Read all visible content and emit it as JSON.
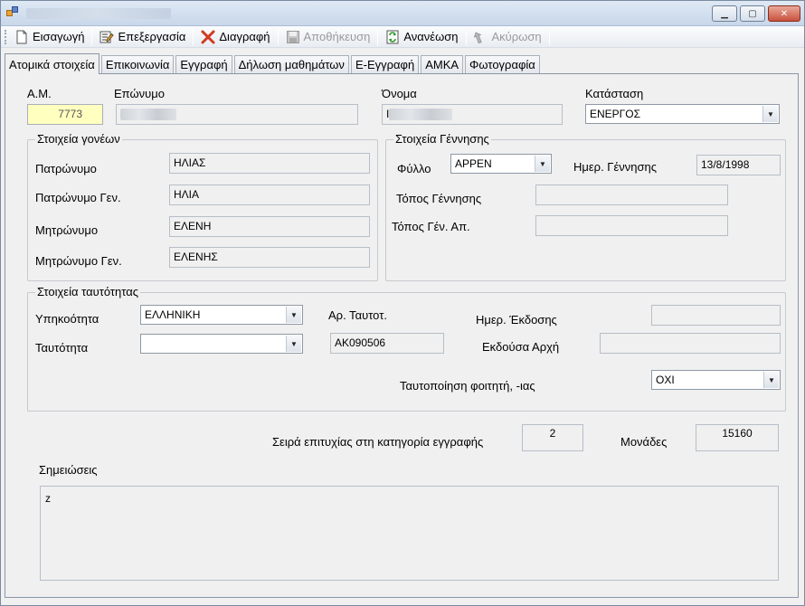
{
  "toolbar": {
    "insert": "Εισαγωγή",
    "edit": "Επεξεργασία",
    "delete": "Διαγραφή",
    "save": "Αποθήκευση",
    "refresh": "Ανανέωση",
    "cancel": "Ακύρωση",
    "disabled": [
      "save",
      "cancel"
    ]
  },
  "tabs": [
    "Ατομικά στοιχεία",
    "Επικοινωνία",
    "Εγγραφή",
    "Δήλωση μαθημάτων",
    "Ε-Εγγραφή",
    "ΑΜΚΑ",
    "Φωτογραφία"
  ],
  "active_tab": "Ατομικά στοιχεία",
  "student": {
    "am_label": "Α.Μ.",
    "am_value": "7773",
    "surname_label": "Επώνυμο",
    "name_label": "Όνομα",
    "name_prefix": "Ι",
    "status_label": "Κατάσταση",
    "status_value": "ΕΝΕΡΓΟΣ"
  },
  "parents": {
    "title": "Στοιχεία γονέων",
    "father_label": "Πατρώνυμο",
    "father_value": "ΗΛΙΑΣ",
    "father_gen_label": "Πατρώνυμο Γεν.",
    "father_gen_value": "ΗΛΙΑ",
    "mother_label": "Μητρώνυμο",
    "mother_value": "ΕΛΕΝΗ",
    "mother_gen_label": "Μητρώνυμο Γεν.",
    "mother_gen_value": "ΕΛΕΝΗΣ"
  },
  "birth": {
    "title": "Στοιχεία Γέννησης",
    "gender_label": "Φύλλο",
    "gender_value": "ΑΡΡΕΝ",
    "date_label": "Ημερ. Γέννησης",
    "date_value": "13/8/1998",
    "place_label": "Τόπος Γέννησης",
    "place_value": "",
    "place_gen_label": "Τόπος Γέν. Απ.",
    "place_gen_value": ""
  },
  "identity": {
    "title": "Στοιχεία ταυτότητας",
    "citizenship_label": "Υπηκοότητα",
    "citizenship_value": "ΕΛΛΗΝΙΚΗ",
    "id_type_label": "Ταυτότητα",
    "id_type_value": "",
    "id_number_label": "Αρ. Ταυτοτ.",
    "id_number_value": "ΑΚ090506",
    "issue_date_label": "Ημερ. Έκδοσης",
    "issue_date_value": "",
    "authority_label": "Εκδούσα Αρχή",
    "authority_value": "",
    "verified_label": "Ταυτοποίηση φοιτητή, -ιας",
    "verified_value": "ΟΧΙ"
  },
  "ranking": {
    "rank_label": "Σειρά επιτυχίας στη κατηγορία εγγραφής",
    "rank_value": "2",
    "points_label": "Μονάδες",
    "points_value": "15160"
  },
  "notes": {
    "label": "Σημειώσεις",
    "value": "z"
  }
}
